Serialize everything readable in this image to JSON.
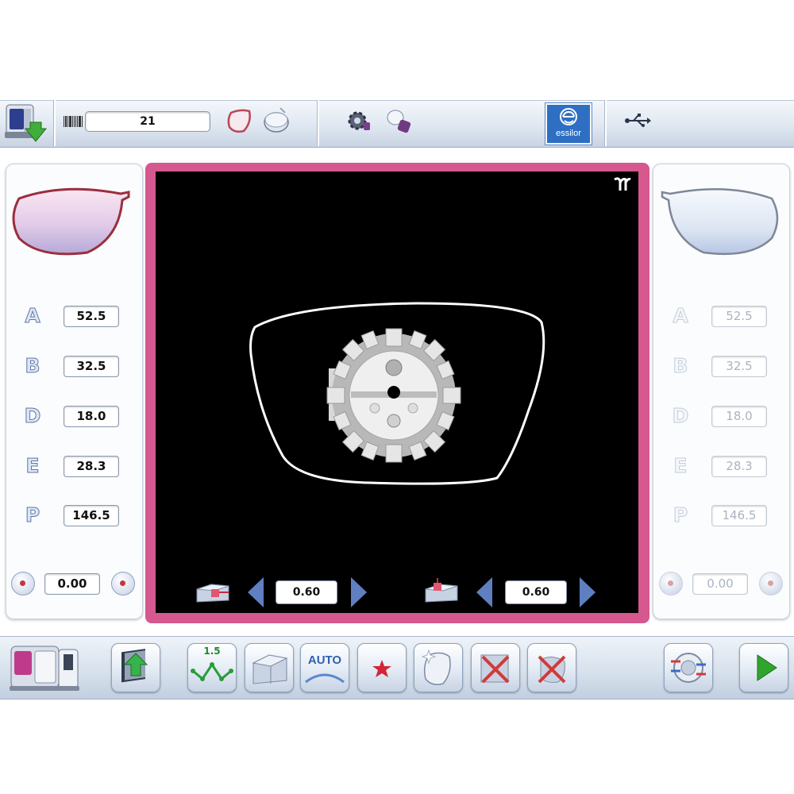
{
  "header": {
    "job_number": "21",
    "brand_logo_text": "essilor"
  },
  "left_panel": {
    "params": [
      {
        "letter": "A",
        "value": "52.5"
      },
      {
        "letter": "B",
        "value": "32.5"
      },
      {
        "letter": "D",
        "value": "18.0"
      },
      {
        "letter": "E",
        "value": "28.3"
      },
      {
        "letter": "P",
        "value": "146.5"
      }
    ],
    "rotation_value": "0.00"
  },
  "right_panel": {
    "params": [
      {
        "letter": "A",
        "value": "52.5"
      },
      {
        "letter": "B",
        "value": "32.5"
      },
      {
        "letter": "D",
        "value": "18.0"
      },
      {
        "letter": "E",
        "value": "28.3"
      },
      {
        "letter": "P",
        "value": "146.5"
      }
    ],
    "rotation_value": "0.00"
  },
  "viewer": {
    "horizontal_offset": "0.60",
    "vertical_offset": "0.60"
  },
  "toolbar": {
    "bevel_height_label": "1.5",
    "auto_label": "AUTO"
  },
  "colors": {
    "frame_highlight": "#d5588f",
    "viewer_background": "#000000",
    "accent_blue": "#5f7fc0",
    "go_green": "#2fa52f",
    "cancel_red": "#d23a3a"
  }
}
